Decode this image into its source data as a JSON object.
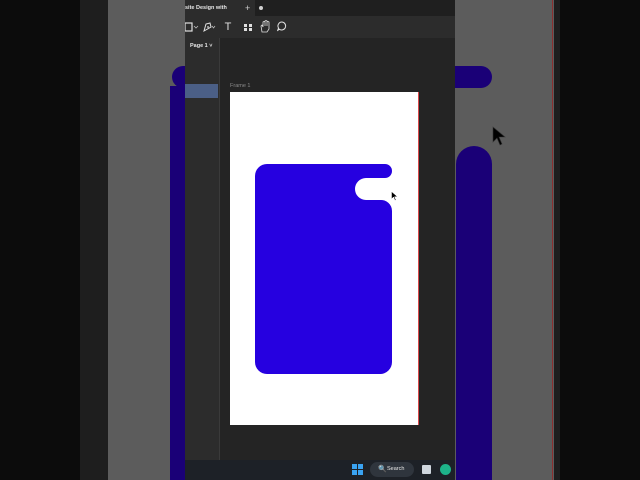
{
  "tab": {
    "title": "site Design with ",
    "new_tab": "+"
  },
  "toolbar": {
    "frame_tool_icon": "frame-icon",
    "pen_tool_icon": "pen-icon",
    "text_tool": "T",
    "components_icon": "components-icon",
    "hand_tool_icon": "hand-icon",
    "comment_tool_icon": "comment-icon"
  },
  "sidebar": {
    "page_label": "Page 1 ˅"
  },
  "canvas": {
    "frame_label": "Frame 1"
  },
  "taskbar": {
    "search_label": "Search",
    "search_icon": "🔍"
  },
  "colors": {
    "shape_fill": "#2600e0",
    "canvas_bg": "#242424",
    "frame_bg": "#ffffff",
    "selection_blue": "#4b5f86"
  }
}
